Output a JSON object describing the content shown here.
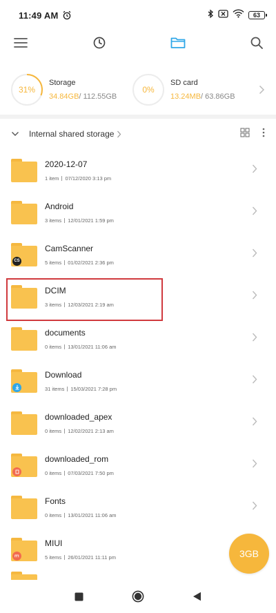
{
  "status_bar": {
    "time": "11:49 AM",
    "battery": "63"
  },
  "toolbar": {
    "icons": [
      "menu-icon",
      "recent-clock-icon",
      "folder-icon",
      "search-icon"
    ],
    "active_color": "#2fa7e8"
  },
  "storage": [
    {
      "percent": "31%",
      "title": "Storage",
      "used": "34.84GB",
      "total": "/ 112.55GB"
    },
    {
      "percent": "0%",
      "title": "SD card",
      "used": "13.24MB",
      "total": "/ 63.86GB"
    }
  ],
  "breadcrumb": {
    "label": "Internal shared storage"
  },
  "files": [
    {
      "name": "2020-12-07",
      "items": "1 item",
      "date": "07/12/2020 3:13 pm",
      "badge": ""
    },
    {
      "name": "Android",
      "items": "3 items",
      "date": "12/01/2021 1:59 pm",
      "badge": ""
    },
    {
      "name": "CamScanner",
      "items": "5 items",
      "date": "01/02/2021 2:36 pm",
      "badge": "CS"
    },
    {
      "name": "DCIM",
      "items": "3 items",
      "date": "12/03/2021 2:19 am",
      "badge": ""
    },
    {
      "name": "documents",
      "items": "0 items",
      "date": "13/01/2021 11:06 am",
      "badge": ""
    },
    {
      "name": "Download",
      "items": "31 items",
      "date": "15/03/2021 7:28 pm",
      "badge": "download"
    },
    {
      "name": "downloaded_apex",
      "items": "0 items",
      "date": "12/02/2021 2:13 am",
      "badge": ""
    },
    {
      "name": "downloaded_rom",
      "items": "0 items",
      "date": "07/03/2021 7:50 pm",
      "badge": "rom"
    },
    {
      "name": "Fonts",
      "items": "0 items",
      "date": "13/01/2021 11:06 am",
      "badge": ""
    },
    {
      "name": "MIUI",
      "items": "5 items",
      "date": "26/01/2021 11:11 pm",
      "badge": "miui"
    }
  ],
  "fab": {
    "label": "3GB"
  },
  "colors": {
    "accent": "#f6b73c",
    "folder": "#f9c24f",
    "highlight": "#d0393d"
  }
}
